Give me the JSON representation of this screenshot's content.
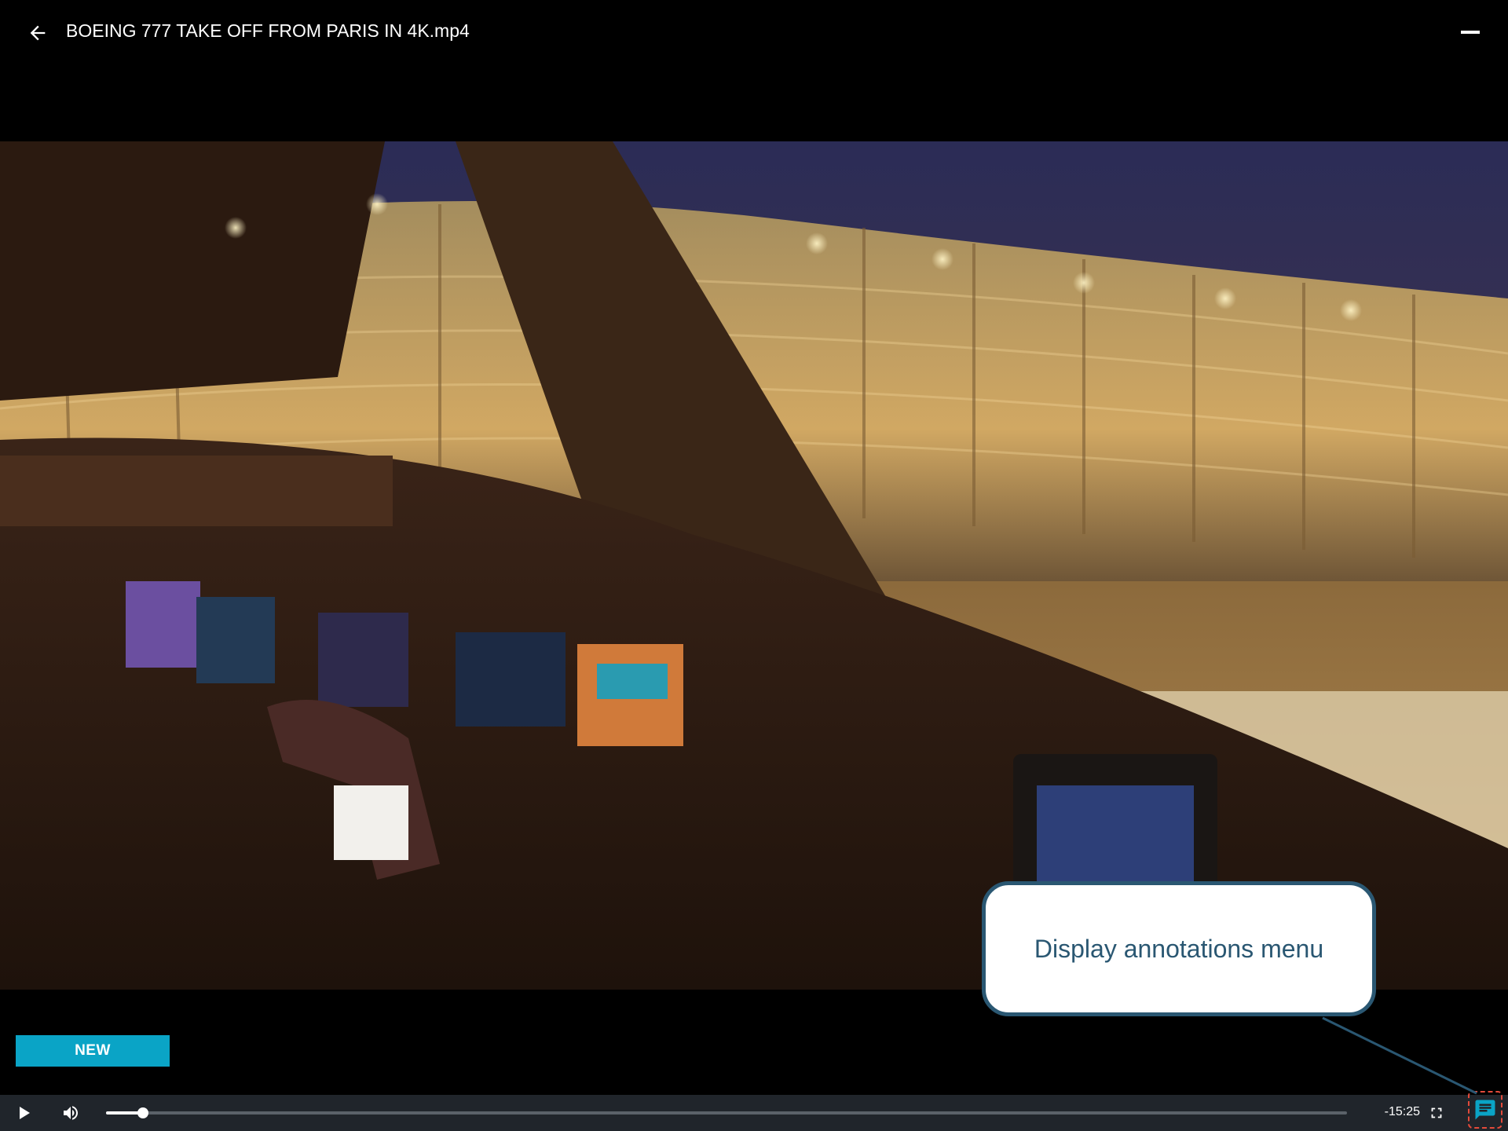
{
  "header": {
    "back_icon": "arrow-left-icon",
    "title": "BOEING 777 TAKE OFF FROM PARIS IN 4K.mp4",
    "minimize_icon": "minimize-icon"
  },
  "video": {
    "frame_description_icon": "video-frame"
  },
  "new_button": {
    "label": "NEW",
    "color": "#0aa4c6"
  },
  "player": {
    "play_icon": "play-icon",
    "volume_icon": "volume-icon",
    "progress_fraction": 0.03,
    "time_remaining": "-15:25",
    "fullscreen_icon": "fullscreen-icon",
    "annotations_icon": "chat-icon",
    "accent_color": "#0aa4c6",
    "highlight_color": "#e34a3a"
  },
  "tooltip": {
    "text": "Display annotations menu",
    "border_color": "#2a5772"
  }
}
